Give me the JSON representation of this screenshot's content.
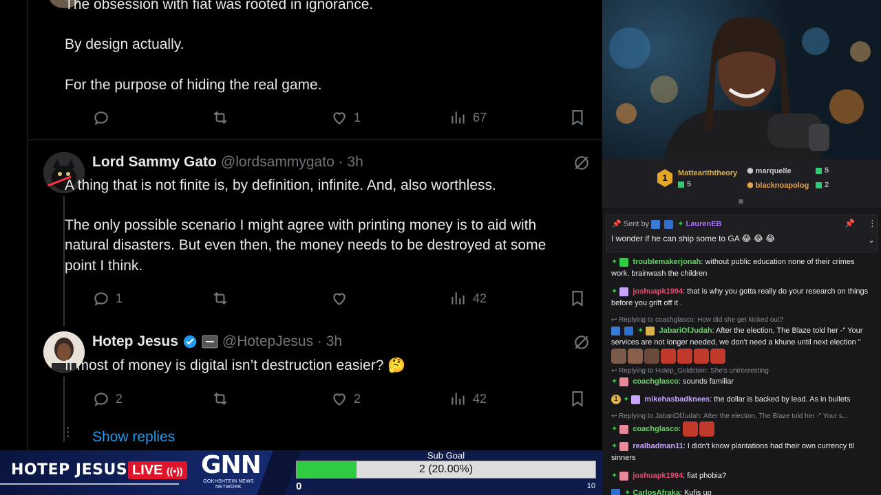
{
  "twitter": {
    "top_post": {
      "line_partial": "The obsession with fiat was rooted in ignorance.",
      "line2": "By design actually.",
      "line3": "For the purpose of hiding the real game.",
      "likes": "1",
      "views": "67"
    },
    "reply1": {
      "name": "Lord Sammy Gato",
      "meta": "@lordsammygato · 3h",
      "line1": "A thing that is not finite is, by definition, infinite. And, also worthless.",
      "line2": "The only possible scenario I might agree with printing money is to aid with",
      "line3": "natural disasters. But even then, the money needs to be destroyed at some",
      "line4": "point I think.",
      "replies": "1",
      "views": "42"
    },
    "reply2": {
      "name": "Hotep Jesus",
      "meta": "@HotepJesus · 3h",
      "text": "If most of money is digital isn’t destruction easier? 🤔",
      "replies": "2",
      "likes": "2",
      "views": "42"
    },
    "show_replies": "Show replies"
  },
  "lower_bar": {
    "title": "HOTEP JESUS",
    "live": "LIVE",
    "network_logo": "GNN",
    "network_name": "GOKHSHTEIN NEWS NETWORK",
    "goal_label": "Sub Goal",
    "goal_text": "2 (20.00%)",
    "goal_fraction": 0.2,
    "goal_min": "0",
    "goal_max": "10",
    "fill_color": "#2ecc40"
  },
  "chat": {
    "leaderboard": [
      {
        "name": "Matteariththeory",
        "count": "5",
        "rank": "1"
      },
      {
        "name": "marquelle",
        "count": "5"
      },
      {
        "name": "blacknoapolog",
        "count": "2"
      }
    ],
    "pinned": {
      "sent_by": "Sent by",
      "user": "LaurenEB",
      "message": "I wonder if he can ship some to GA 😂 😂 😂"
    },
    "messages": [
      {
        "user": "troublemakerjonah",
        "color": "#67d367",
        "text": ": without public education none of their crimes work. brainwash the children"
      },
      {
        "user": "joshuapk1994",
        "color": "#e84a6f",
        "text": ": that is why you gotta really do your research on things before you grift off it ."
      },
      {
        "reply": "Replying to coachglasco: How did she get kicked out?"
      },
      {
        "user": "JabariOfJudah",
        "color": "#67d367",
        "text": ": After the election, The Blaze told her -\" Your services are not longer needed, we don't need a khune until next election \""
      },
      {
        "reply": "Replying to Hotep_Goldstein: She's uninteresting"
      },
      {
        "user": "coachglasco",
        "color": "#67d367",
        "text": ": sounds familiar"
      },
      {
        "user": "mikehasbadknees",
        "color": "#c6a4ff",
        "text": ": the dollar is backed by lead. As in bullets"
      },
      {
        "reply": "Replying to JabariOfJudah: After the election, The Blaze told her -\" Your s..."
      },
      {
        "user": "coachglasco",
        "color": "#67d367",
        "text": ":"
      },
      {
        "user": "realbadman11",
        "color": "#c6a4ff",
        "text": ": I didn't know plantations had their own currency til sinners"
      },
      {
        "user": "joshuapk1994",
        "color": "#e84a6f",
        "text": ": fiat phobia?"
      },
      {
        "user": "CarlosAfraka",
        "color": "#67d367",
        "text": ": Kufis up"
      }
    ]
  }
}
